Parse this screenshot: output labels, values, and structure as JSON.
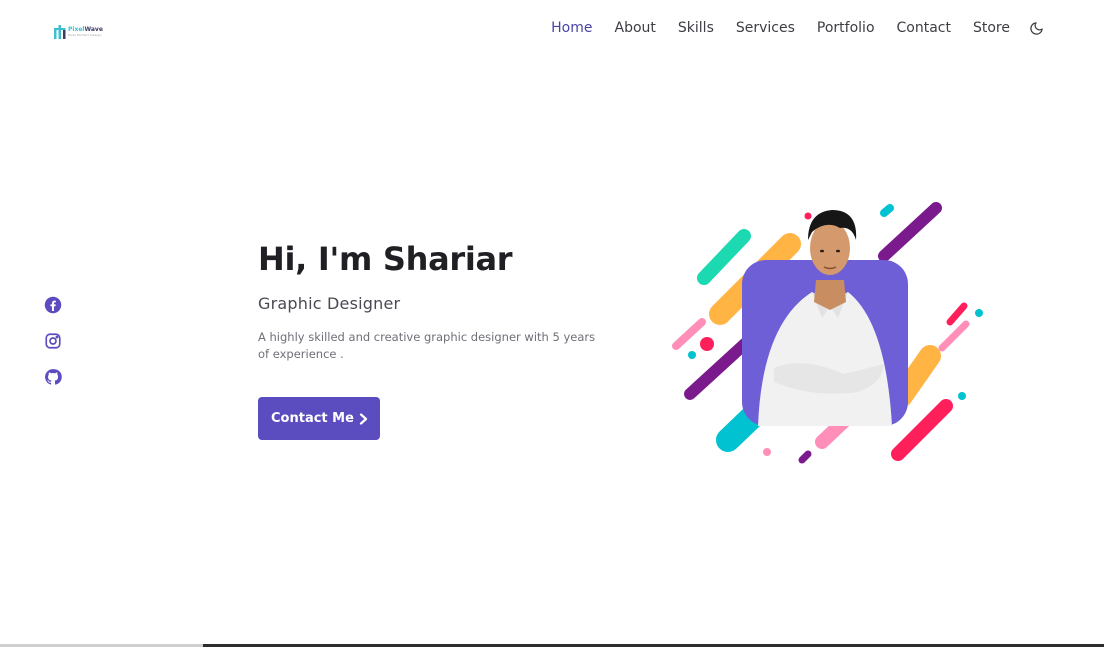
{
  "brand": {
    "name_part1": "Pixel",
    "name_part2": "Wave",
    "tagline": "Pixel Perfect Design",
    "accent_color": "#3ebfcf"
  },
  "nav": {
    "items": [
      {
        "label": "Home",
        "active": true
      },
      {
        "label": "About"
      },
      {
        "label": "Skills"
      },
      {
        "label": "Services"
      },
      {
        "label": "Portfolio"
      },
      {
        "label": "Contact"
      },
      {
        "label": "Store"
      }
    ],
    "theme_toggle_icon": "moon-icon"
  },
  "social": [
    {
      "icon": "facebook-icon"
    },
    {
      "icon": "instagram-icon"
    },
    {
      "icon": "github-icon"
    }
  ],
  "hero": {
    "title": "Hi, I'm Shariar",
    "subtitle": "Graphic Designer",
    "description": "A highly skilled and creative graphic designer with 5 years of experience .",
    "cta_label": "Contact Me",
    "cta_icon": "chevron-right-icon"
  },
  "colors": {
    "primary": "#5b4dbf",
    "photo_frame": "#6e5fd6",
    "confetti": [
      "#1dd9b2",
      "#ffb444",
      "#7a1a8c",
      "#ff1f5a",
      "#ff8fb8",
      "#00c2d1"
    ]
  }
}
